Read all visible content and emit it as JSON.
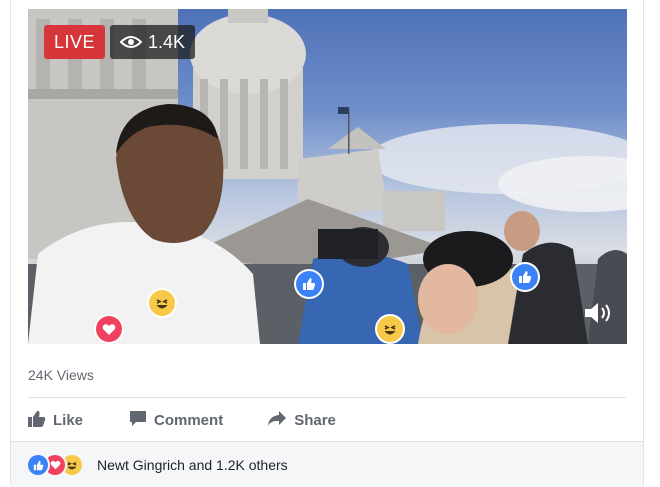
{
  "video": {
    "live_label": "LIVE",
    "viewer_count": "1.4K",
    "icons": [
      "eye-icon",
      "volume-icon",
      "like-reaction-icon",
      "love-reaction-icon",
      "haha-reaction-icon"
    ]
  },
  "stats": {
    "views": "24K Views"
  },
  "actions": {
    "like_label": "Like",
    "comment_label": "Comment",
    "share_label": "Share"
  },
  "reactions_summary": {
    "text": "Newt Gingrich and 1.2K others",
    "reaction_types": [
      "like",
      "love",
      "haha"
    ]
  },
  "colors": {
    "live_red": "#d6363a",
    "like_blue": "#3b82f6",
    "love_red": "#f0415f",
    "haha_yellow": "#f7c948",
    "action_gray": "#606770"
  }
}
